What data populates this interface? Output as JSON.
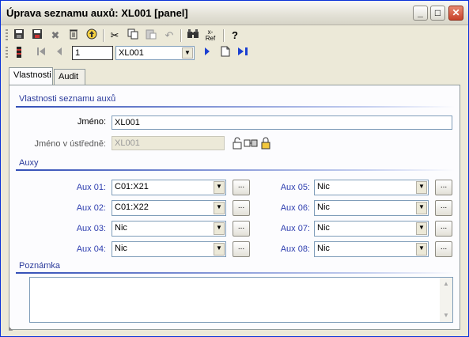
{
  "window": {
    "title": "Úprava seznamu auxů: XL001 [panel]"
  },
  "navigation": {
    "record_number": "1",
    "record_combo": "XL001"
  },
  "tabs": [
    {
      "label": "Vlastnosti"
    },
    {
      "label": "Audit"
    }
  ],
  "properties": {
    "section_title": "Vlastnosti seznamu auxů",
    "name_label": "Jméno:",
    "name_value": "XL001",
    "central_name_label": "Jméno v ústředně:",
    "central_name_value": "XL001"
  },
  "auxes": {
    "section_title": "Auxy",
    "items": [
      {
        "label": "Aux 01:",
        "value": "C01:X21"
      },
      {
        "label": "Aux 02:",
        "value": "C01:X22"
      },
      {
        "label": "Aux 03:",
        "value": "Nic"
      },
      {
        "label": "Aux 04:",
        "value": "Nic"
      },
      {
        "label": "Aux 05:",
        "value": "Nic"
      },
      {
        "label": "Aux 06:",
        "value": "Nic"
      },
      {
        "label": "Aux 07:",
        "value": "Nic"
      },
      {
        "label": "Aux 08:",
        "value": "Nic"
      }
    ],
    "browse_label": "..."
  },
  "note": {
    "section_title": "Poznámka",
    "value": ""
  },
  "toolbar_ref_label": "x-\nRef"
}
